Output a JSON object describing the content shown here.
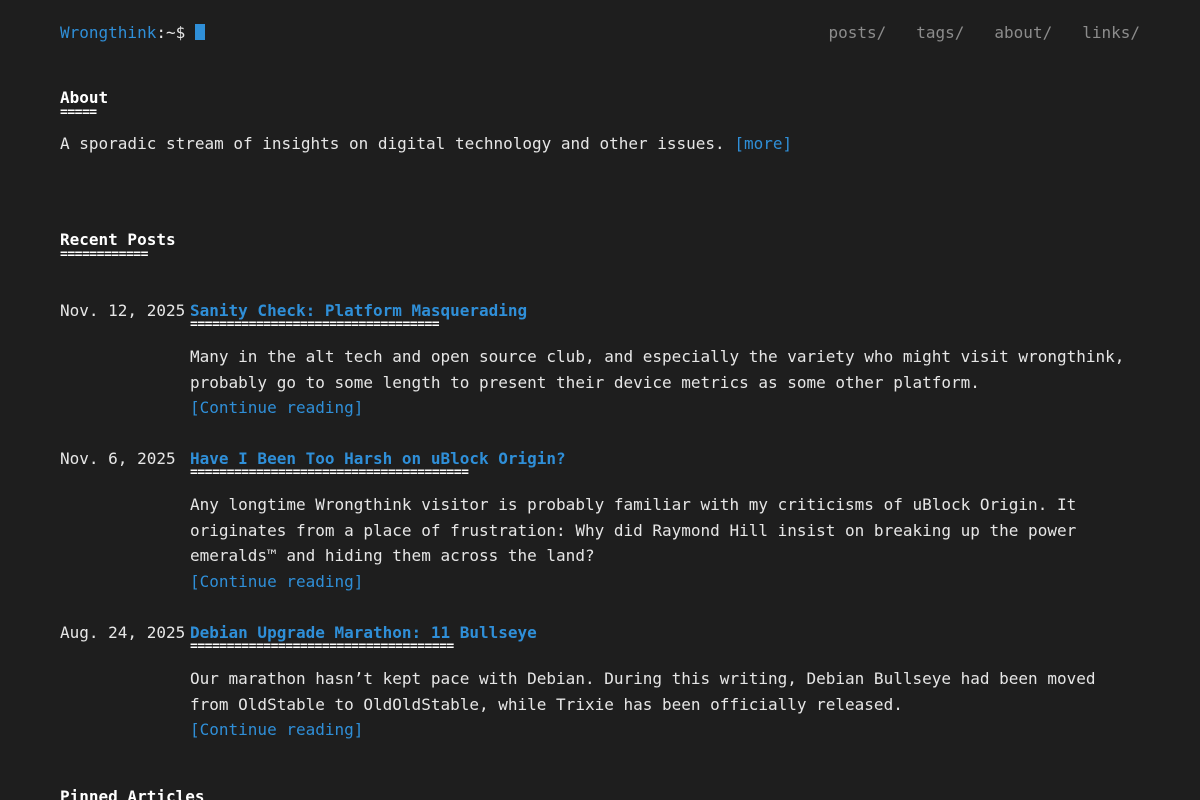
{
  "header": {
    "site_name": "Wrongthink",
    "prompt": ":~$",
    "nav": [
      "posts/",
      "tags/",
      "about/",
      "links/"
    ]
  },
  "about": {
    "title": "About",
    "underline": "=====",
    "text": "A sporadic stream of insights on digital technology and other issues.",
    "more_link": "[more]"
  },
  "recent_posts": {
    "title": "Recent Posts",
    "underline": "============",
    "posts": [
      {
        "date": "Nov. 12, 2025",
        "title": "Sanity Check: Platform Masquerading",
        "underline": "==================================",
        "summary": "Many in the alt tech and open source club, and especially the variety who might visit wrongthink, probably go to some length to present their device metrics as some other platform.",
        "continue": "[Continue reading]"
      },
      {
        "date": "Nov. 6, 2025",
        "title": "Have I Been Too Harsh on uBlock Origin?",
        "underline": "======================================",
        "summary": "Any longtime Wrongthink visitor is probably familiar with my criticisms of uBlock Origin. It originates from a place of frustration: Why did Raymond Hill insist on breaking up the power emeralds™ and hiding them across the land?",
        "continue": "[Continue reading]"
      },
      {
        "date": "Aug. 24, 2025",
        "title": "Debian Upgrade Marathon: 11 Bullseye",
        "underline": "====================================",
        "summary": "Our marathon hasn’t kept pace with Debian. During this writing, Debian Bullseye had been moved from OldStable to OldOldStable, while Trixie has been officially released.",
        "continue": "[Continue reading]"
      }
    ]
  },
  "pinned": {
    "title": "Pinned Articles"
  }
}
